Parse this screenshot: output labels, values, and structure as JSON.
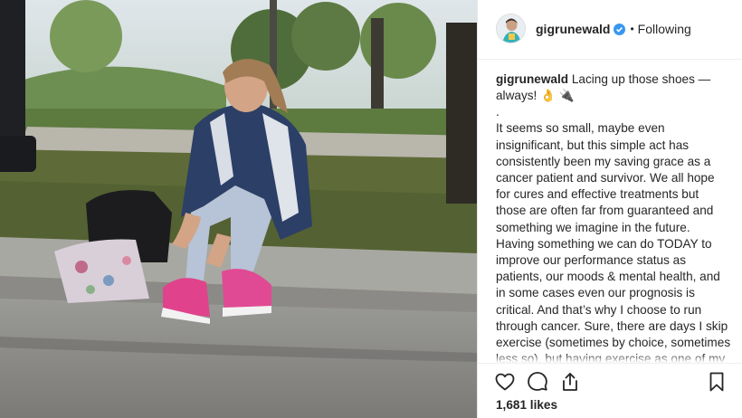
{
  "post": {
    "username": "gigrunewald",
    "follow_status": "Following",
    "separator": "•",
    "caption_username": "gigrunewald",
    "caption_first": "Lacing up those shoes — always! 👌 🔌",
    "caption_dot": ".",
    "caption_body": "It seems so small, maybe even insignificant, but this simple act has consistently been my saving grace as a cancer patient and survivor. We all hope for cures and effective treatments but those are often far from guaranteed and something we imagine in the future. Having something we can do TODAY to improve our performance status as patients, our moods & mental health, and in some cases even our prognosis is critical. And that’s why I choose to run through cancer. Sure, there are days I skip exercise (sometimes by choice, sometimes less so), but having exercise as one of my goals and a part of my routine despite the ongoing challenges of my treatments and diagnosis has been immensely helpful to my mind,",
    "likes": "1,681 likes"
  },
  "icons": {
    "verified": "verified-badge-icon",
    "like": "heart-icon",
    "comment": "comment-icon",
    "share": "share-icon",
    "save": "bookmark-icon"
  },
  "colors": {
    "verified_blue": "#3897f0",
    "text": "#262626",
    "divider": "#efefef"
  }
}
